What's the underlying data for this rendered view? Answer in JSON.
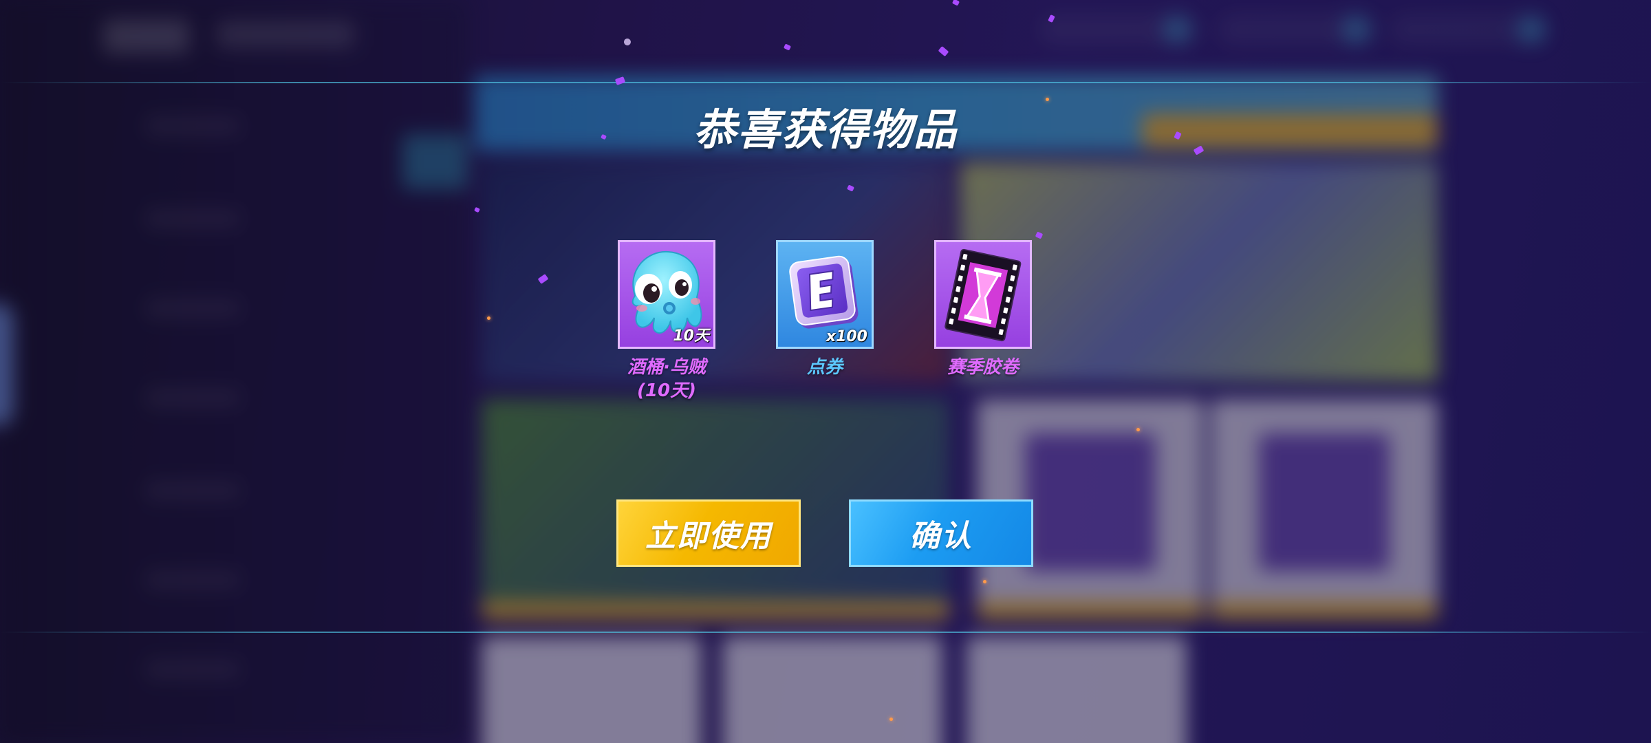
{
  "dialog": {
    "title": "恭喜获得物品"
  },
  "rewards": [
    {
      "name": "酒桶·乌贼",
      "name_line2": "(10天)",
      "quantity": "10天",
      "icon": "octopus-icon",
      "name_color": "#e06bff",
      "frame": "purple"
    },
    {
      "name": "点券",
      "name_line2": "",
      "quantity": "x100",
      "icon": "e-coupon-icon",
      "name_color": "#5cc8ff",
      "frame": "blue"
    },
    {
      "name": "赛季胶卷",
      "name_line2": "",
      "quantity": "",
      "icon": "season-film-icon",
      "name_color": "#e06bff",
      "frame": "purple"
    }
  ],
  "buttons": {
    "use_now": "立即使用",
    "confirm": "确认"
  },
  "colors": {
    "use_button": "#f5b800",
    "confirm_button": "#1c9cf2",
    "purple_frame": "#a652ea",
    "blue_frame": "#3d9ae8"
  }
}
